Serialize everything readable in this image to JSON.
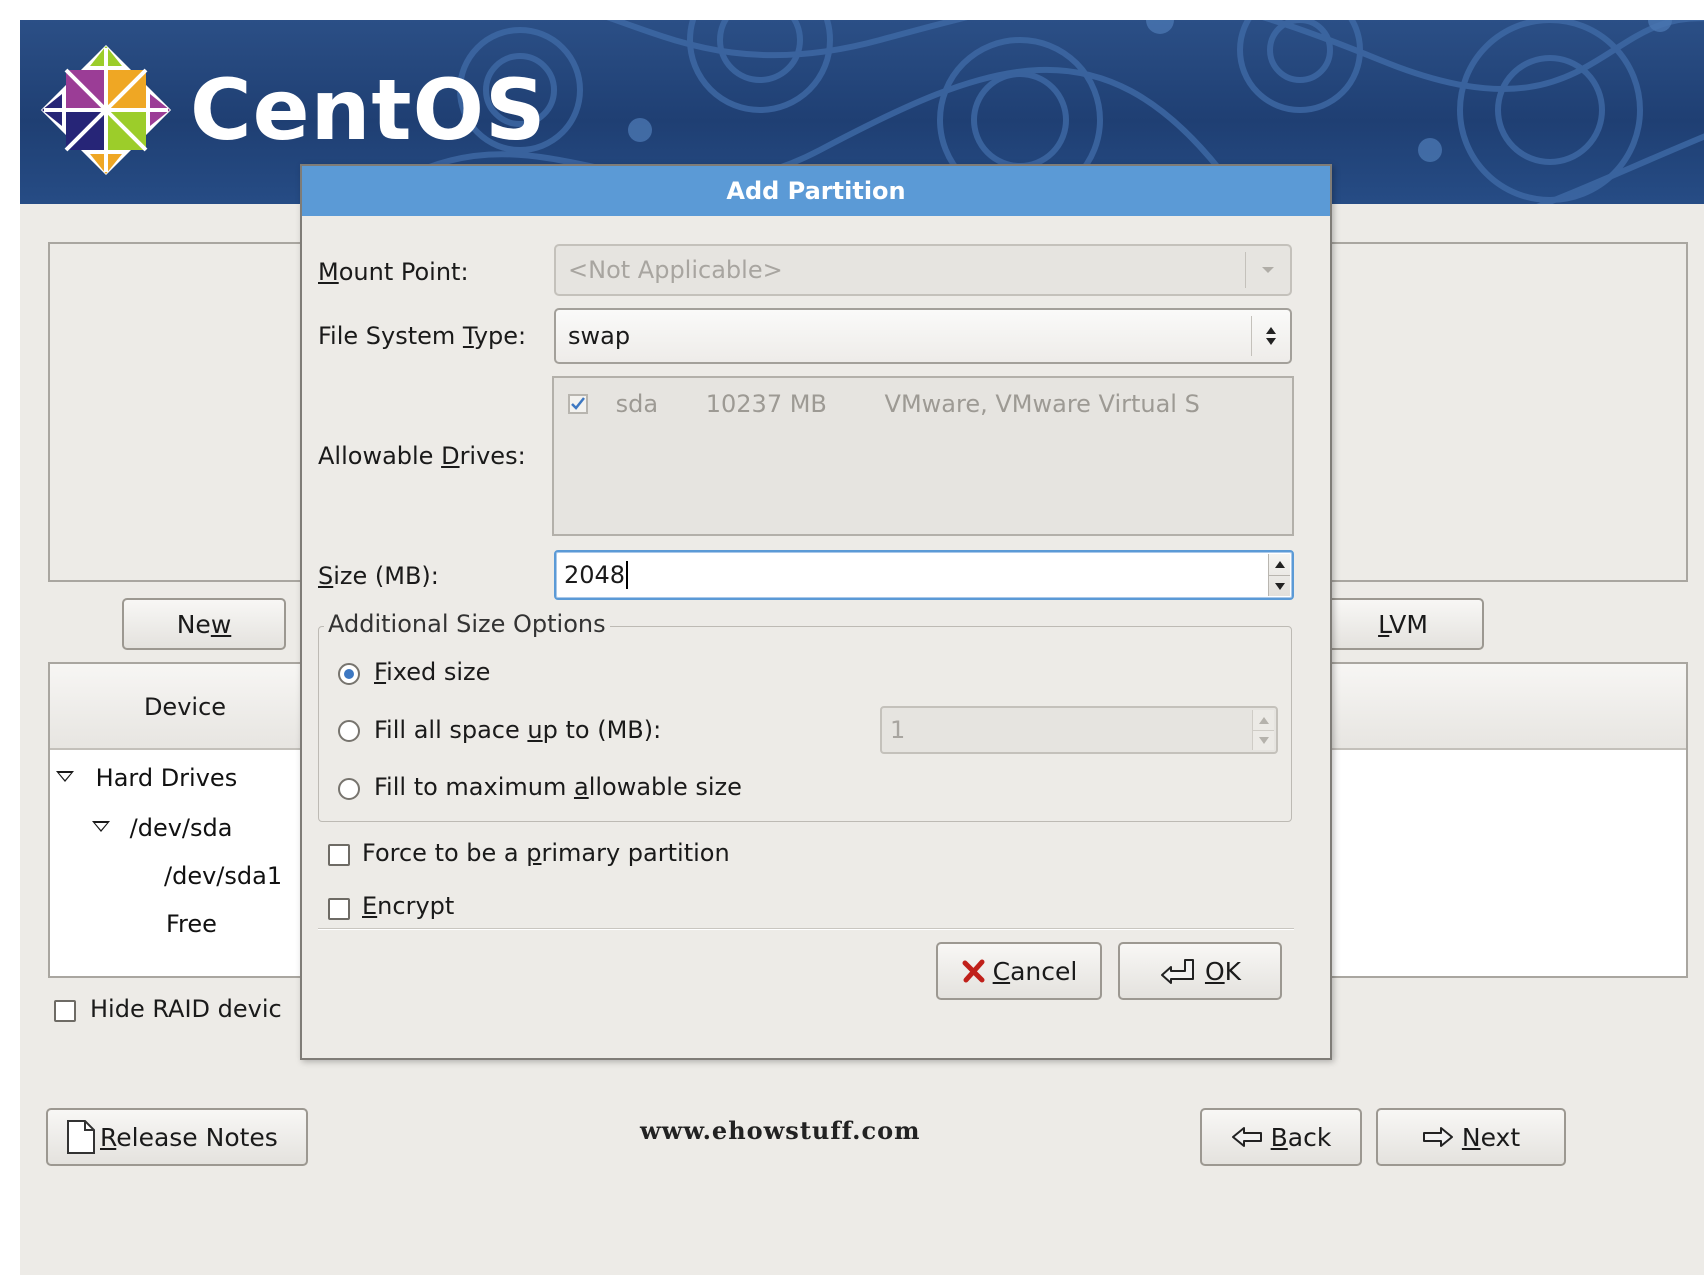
{
  "brand": {
    "name": "CentOS"
  },
  "colors": {
    "banner": "#1f3f73",
    "dialog_title_bar": "#5b9ad6",
    "focus": "#5b9ad6",
    "background": "#edebe7"
  },
  "background_window": {
    "buttons": {
      "new_label_pre": "Ne",
      "new_label_ul": "w",
      "new_label_post": "",
      "lvm_label_pre": "",
      "lvm_label_ul": "L",
      "lvm_label_post": "VM"
    },
    "table": {
      "column_device": "Device",
      "tree": [
        {
          "label": "Hard Drives",
          "expanded": true
        },
        {
          "label": "/dev/sda",
          "expanded": true
        },
        {
          "label": "/dev/sda1"
        },
        {
          "label": "Free"
        }
      ]
    },
    "hide_raid_label": "Hide RAID devic",
    "release_notes_pre": "",
    "release_notes_ul": "R",
    "release_notes_post": "elease Notes",
    "back_pre": "",
    "back_ul": "B",
    "back_post": "ack",
    "next_pre": "",
    "next_ul": "N",
    "next_post": "ext",
    "watermark": "www.ehowstuff.com"
  },
  "dialog": {
    "title": "Add Partition",
    "mount_point": {
      "label_ul": "M",
      "label_post": "ount Point:",
      "value": "<Not Applicable>"
    },
    "fs_type": {
      "label_pre": "File System ",
      "label_ul": "T",
      "label_post": "ype:",
      "value": "swap"
    },
    "allowable_drives": {
      "label_pre": "Allowable ",
      "label_ul": "D",
      "label_post": "rives:",
      "drive": {
        "name": "sda",
        "size": "10237 MB",
        "model": "VMware, VMware Virtual S",
        "checked": true
      }
    },
    "size": {
      "label_ul": "S",
      "label_post": "ize (MB):",
      "value": "2048"
    },
    "additional": {
      "legend": "Additional Size Options",
      "fixed_ul": "F",
      "fixed_post": "ixed size",
      "fill_up_pre": "Fill all space ",
      "fill_up_ul": "u",
      "fill_up_post": "p to (MB):",
      "fill_up_value": "1",
      "fill_max_pre": "Fill to maximum ",
      "fill_max_ul": "a",
      "fill_max_post": "llowable size",
      "selected": "fixed"
    },
    "force_primary": {
      "pre": "Force to be a ",
      "ul": "p",
      "post": "rimary partition",
      "checked": false
    },
    "encrypt": {
      "ul": "E",
      "post": "ncrypt",
      "checked": false
    },
    "cancel_ul": "C",
    "cancel_post": "ancel",
    "ok_ul": "O",
    "ok_post": "K"
  }
}
